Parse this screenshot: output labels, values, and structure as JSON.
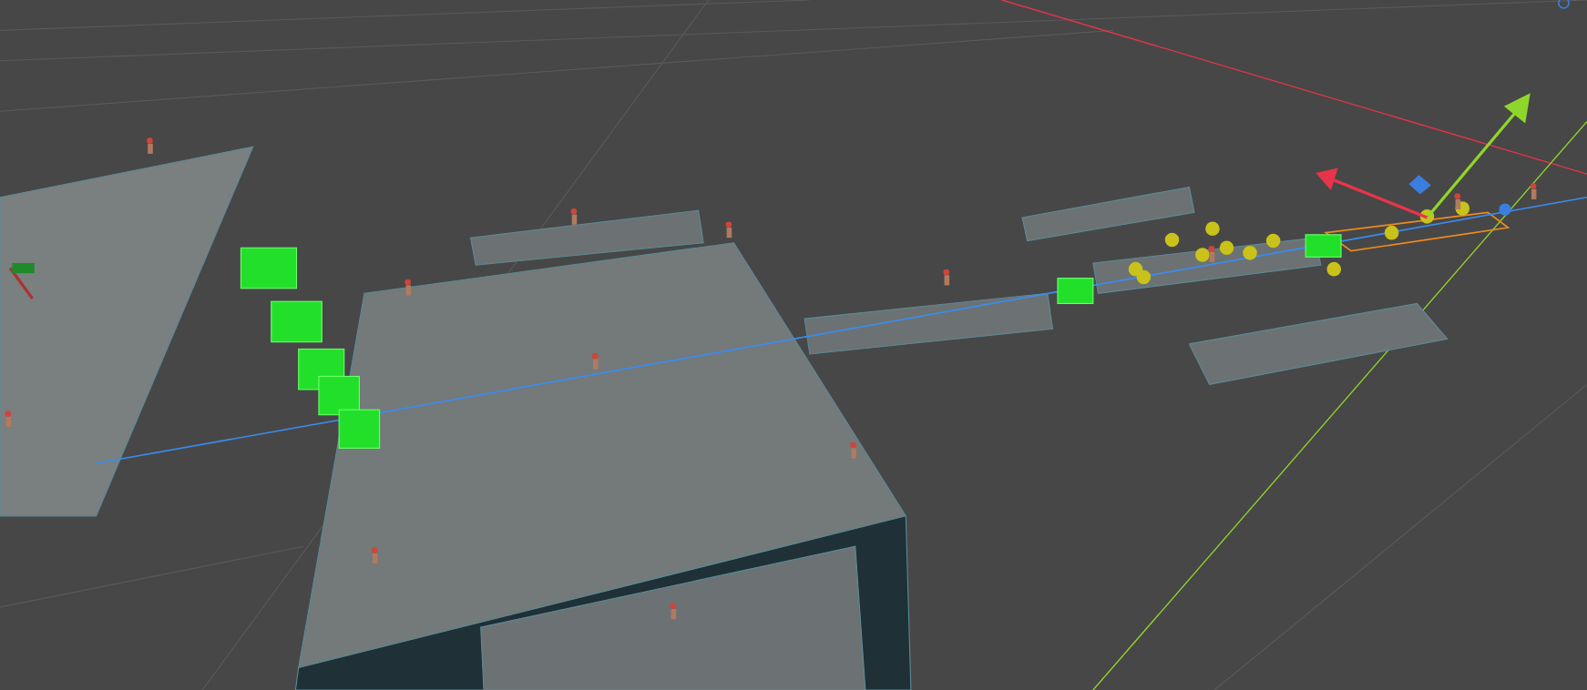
{
  "scene_view": {
    "gizmo": {
      "kind": "move"
    }
  }
}
